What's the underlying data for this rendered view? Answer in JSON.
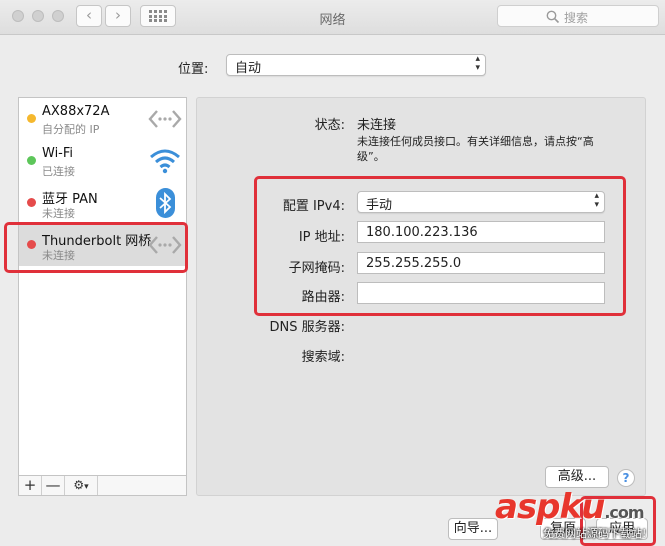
{
  "window": {
    "title": "网络"
  },
  "search": {
    "placeholder": "搜索"
  },
  "location": {
    "label": "位置:",
    "value": "自动"
  },
  "services": [
    {
      "name": "AX88x72A",
      "status": "自分配的 IP",
      "dot_color": "#f5b82e",
      "icon": "ethernet-arrows-icon"
    },
    {
      "name": "Wi-Fi",
      "status": "已连接",
      "dot_color": "#5dc65a",
      "icon": "wifi-icon"
    },
    {
      "name": "蓝牙 PAN",
      "status": "未连接",
      "dot_color": "#e54b4b",
      "icon": "bluetooth-icon"
    },
    {
      "name": "Thunderbolt 网桥",
      "status": "未连接",
      "dot_color": "#e54b4b",
      "icon": "ethernet-arrows-icon"
    }
  ],
  "service_toolbar": {
    "add": "+",
    "remove": "—",
    "gear": "⚙"
  },
  "detail": {
    "status_label": "状态:",
    "status_value": "未连接",
    "status_desc_line1": "未连接任何成员接口。有关详细信息，请点按“高",
    "status_desc_line2": "级”。",
    "ipv4_label": "配置 IPv4:",
    "ipv4_value": "手动",
    "ip_label": "IP 地址:",
    "ip_value": "180.100.223.136",
    "mask_label": "子网掩码:",
    "mask_value": "255.255.255.0",
    "router_label": "路由器:",
    "router_value": "",
    "dns_label": "DNS 服务器:",
    "search_domain_label": "搜索域:"
  },
  "buttons": {
    "advanced": "高级...",
    "help": "?",
    "assistant": "向导...",
    "revert": "复原",
    "apply": "应用"
  },
  "watermark": {
    "logo": "aspku",
    "logo_suffix": ".com",
    "subtitle": "免费网站源码下载站!"
  },
  "colors": {
    "highlight": "#e0303a",
    "accent": "#4a90e2"
  }
}
